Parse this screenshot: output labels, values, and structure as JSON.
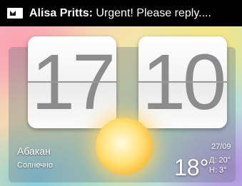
{
  "status_bar": {
    "icon": "message-icon",
    "sender": "Alisa Pritts:",
    "message": " Urgent! Please reply...."
  },
  "clock": {
    "hours": "17",
    "minutes": "10"
  },
  "weather": {
    "city": "Абакан",
    "condition": "Солнечно",
    "date": "27/09",
    "temperature": "18°",
    "high": "Д: 20°",
    "low": "Н:  3°",
    "icon": "sun-icon"
  }
}
